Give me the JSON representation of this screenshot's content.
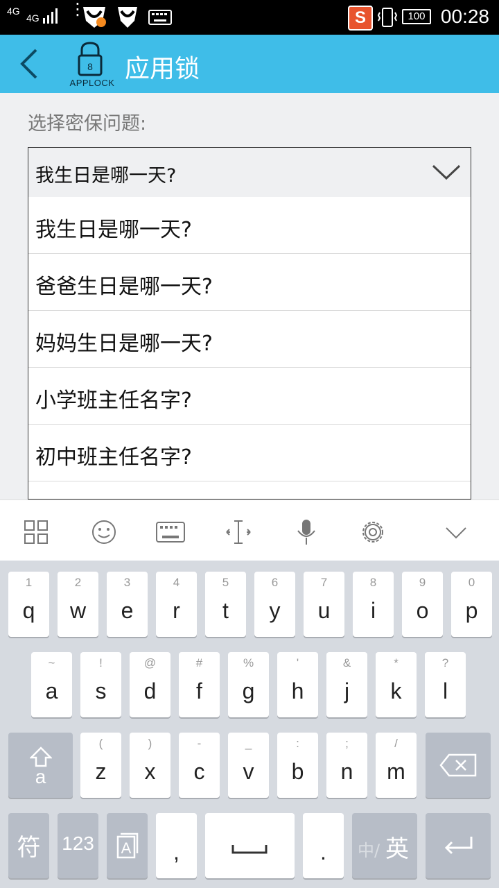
{
  "status_bar": {
    "net1": "4G",
    "net2": "4G",
    "battery": "100",
    "time": "00:28"
  },
  "header": {
    "app_logo_text": "APPLOCK",
    "title": "应用锁"
  },
  "form": {
    "label": "选择密保问题:",
    "selected": "我生日是哪一天?",
    "options": [
      "我生日是哪一天?",
      "爸爸生日是哪一天?",
      "妈妈生日是哪一天?",
      "小学班主任名字?",
      "初中班主任名字?"
    ]
  },
  "keyboard": {
    "row1": [
      {
        "n": "1",
        "k": "q"
      },
      {
        "n": "2",
        "k": "w"
      },
      {
        "n": "3",
        "k": "e"
      },
      {
        "n": "4",
        "k": "r"
      },
      {
        "n": "5",
        "k": "t"
      },
      {
        "n": "6",
        "k": "y"
      },
      {
        "n": "7",
        "k": "u"
      },
      {
        "n": "8",
        "k": "i"
      },
      {
        "n": "9",
        "k": "o"
      },
      {
        "n": "0",
        "k": "p"
      }
    ],
    "row2": [
      {
        "n": "~",
        "k": "a"
      },
      {
        "n": "!",
        "k": "s"
      },
      {
        "n": "@",
        "k": "d"
      },
      {
        "n": "#",
        "k": "f"
      },
      {
        "n": "%",
        "k": "g"
      },
      {
        "n": "'",
        "k": "h"
      },
      {
        "n": "&",
        "k": "j"
      },
      {
        "n": "*",
        "k": "k"
      },
      {
        "n": "?",
        "k": "l"
      }
    ],
    "row3": [
      {
        "n": "(",
        "k": "z"
      },
      {
        "n": ")",
        "k": "x"
      },
      {
        "n": "-",
        "k": "c"
      },
      {
        "n": "_",
        "k": "v"
      },
      {
        "n": ":",
        "k": "b"
      },
      {
        "n": ";",
        "k": "n"
      },
      {
        "n": "/",
        "k": "m"
      }
    ],
    "shift_sub": "a",
    "symbols": "符",
    "numbers": "123",
    "comma": ",",
    "period": ".",
    "lang_cn": "中/",
    "lang_en": "英"
  },
  "colors": {
    "accent": "#3fbde8",
    "key_dark": "#b7bdc7"
  }
}
